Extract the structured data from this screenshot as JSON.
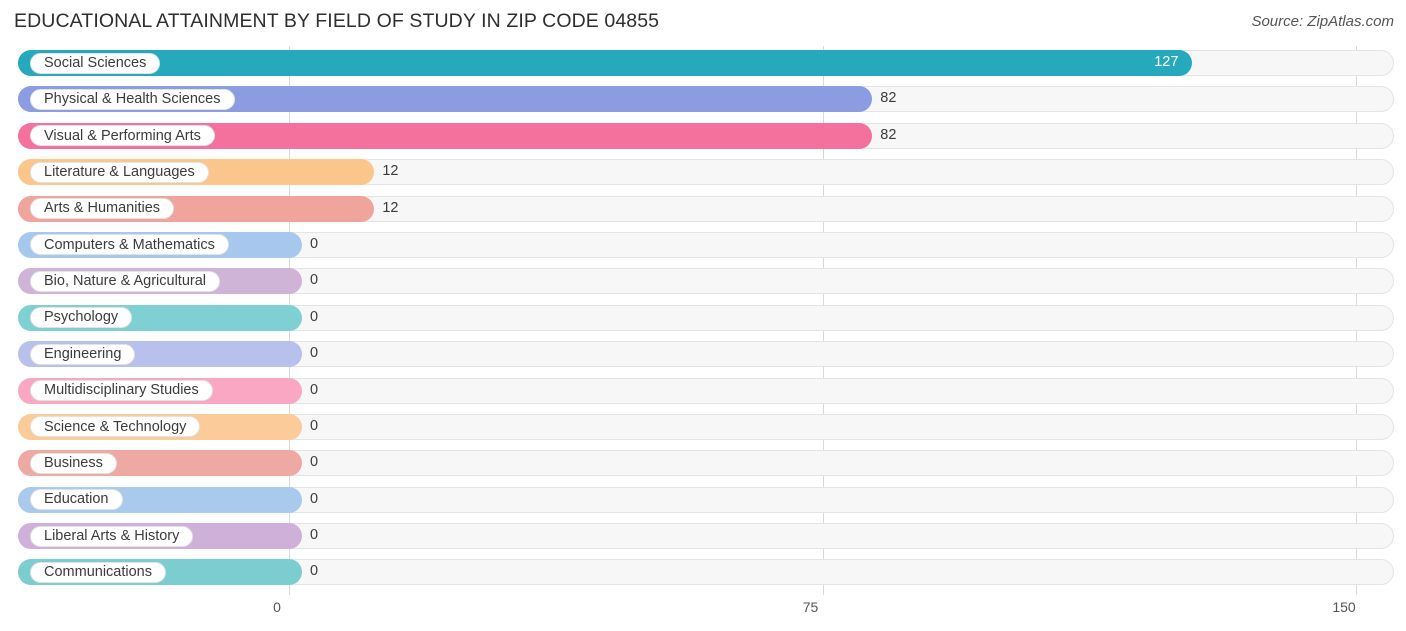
{
  "header": {
    "title": "EDUCATIONAL ATTAINMENT BY FIELD OF STUDY IN ZIP CODE 04855",
    "source": "Source: ZipAtlas.com"
  },
  "chart_data": {
    "type": "bar",
    "orientation": "horizontal",
    "title": "EDUCATIONAL ATTAINMENT BY FIELD OF STUDY IN ZIP CODE 04855",
    "xlabel": "",
    "ylabel": "",
    "xlim": [
      0,
      150
    ],
    "xticks": [
      "0",
      "75",
      "150"
    ],
    "xtick_values": [
      0,
      75,
      150
    ],
    "grid": true,
    "legend": false,
    "categories": [
      "Social Sciences",
      "Physical & Health Sciences",
      "Visual & Performing Arts",
      "Literature & Languages",
      "Arts & Humanities",
      "Computers & Mathematics",
      "Bio, Nature & Agricultural",
      "Psychology",
      "Engineering",
      "Multidisciplinary Studies",
      "Science & Technology",
      "Business",
      "Education",
      "Liberal Arts & History",
      "Communications"
    ],
    "values": [
      127,
      82,
      82,
      12,
      12,
      0,
      0,
      0,
      0,
      0,
      0,
      0,
      0,
      0,
      0
    ],
    "value_labels": [
      "127",
      "82",
      "82",
      "12",
      "12",
      "0",
      "0",
      "0",
      "0",
      "0",
      "0",
      "0",
      "0",
      "0",
      "0"
    ],
    "colors": [
      "#27a9bd",
      "#8b9ce0",
      "#f4719d",
      "#fac68c",
      "#efa49c",
      "#a6c8ec",
      "#cfb4d8",
      "#7fd0d2",
      "#b8c0ec",
      "#f9a7c2",
      "#fbcb99",
      "#eda9a2",
      "#a9caec",
      "#cfb0d9",
      "#7ccdd0"
    ]
  },
  "axis": {
    "ticks": [
      "0",
      "75",
      "150"
    ]
  }
}
